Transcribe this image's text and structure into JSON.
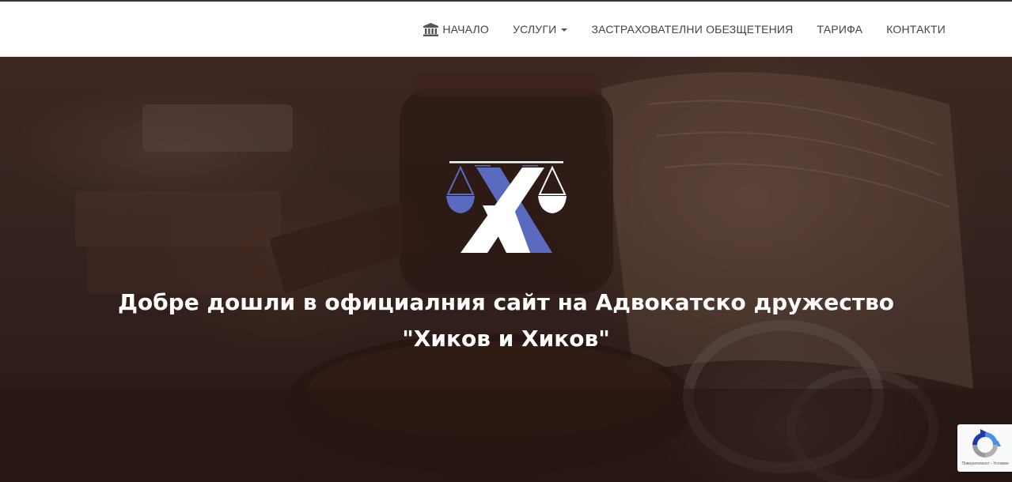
{
  "nav": {
    "items": [
      {
        "label": "НАЧАЛО",
        "icon": "bank-icon"
      },
      {
        "label": "УСЛУГИ",
        "icon": "caret-down-icon"
      },
      {
        "label": "ЗАСТРАХОВАТЕЛНИ ОБЕЗЩЕТЕНИЯ"
      },
      {
        "label": "ТАРИФА"
      },
      {
        "label": "КОНТАКТИ"
      }
    ]
  },
  "hero": {
    "headline_line1": "Добре дошли в официалния сайт на Адвокатско дружество",
    "headline_line2": "\"Хиков и Хиков\"",
    "logo": "scales-x-logo"
  },
  "recaptcha": {
    "label": "Поверителност - Условия"
  },
  "colors": {
    "logo_blue": "#5a6bbf",
    "nav_text": "#444444",
    "hero_overlay": "#3d2824"
  }
}
